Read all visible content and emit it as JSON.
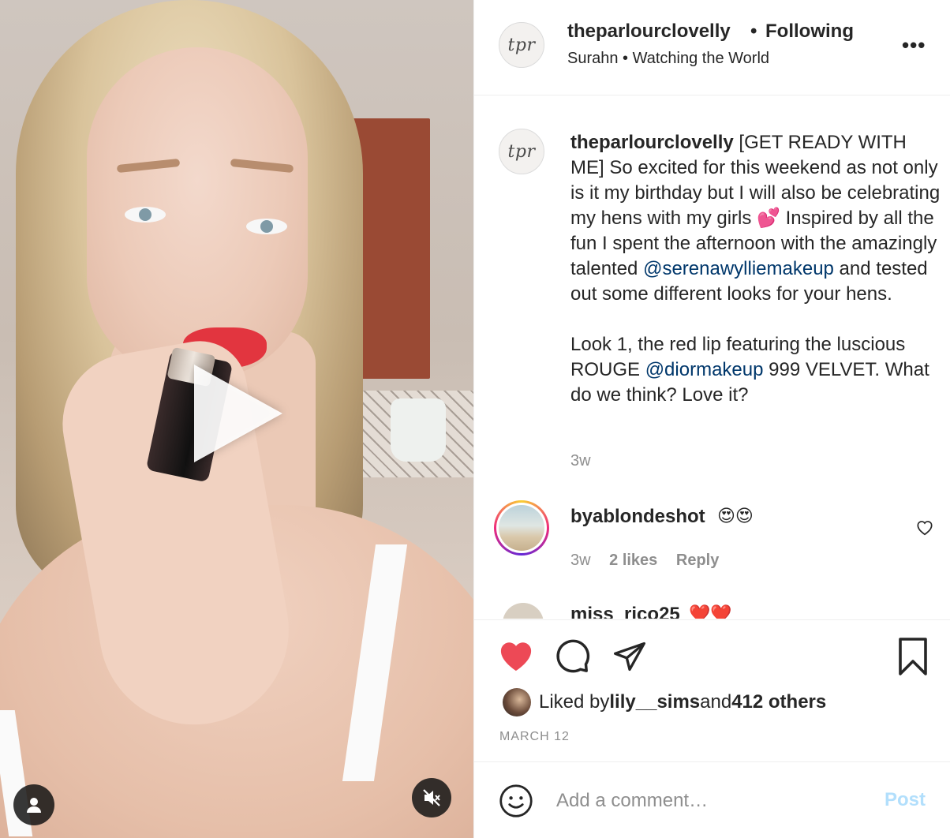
{
  "post": {
    "media": {
      "type": "video"
    },
    "header": {
      "avatar_text": "tpr",
      "username": "theparlourclovelly",
      "separator": "•",
      "follow_status": "Following",
      "subtitle": "Surahn • Watching the World",
      "more": "•••"
    },
    "caption": {
      "username": "theparlourclovelly",
      "text_1": " [GET READY WITH ME] So excited for this weekend as not only is it my birthday but I will also be celebrating my hens with my girls 💕 Inspired by all the fun I spent the afternoon with the amazingly talented ",
      "mention_1": "@serenawylliemakeup",
      "text_2": " and tested out some different looks for your hens.",
      "text_3": "Look 1, the red lip featuring the luscious ROUGE ",
      "mention_2": "@diormakeup",
      "text_4": " 999 VELVET. What do we think? Love it?",
      "time": "3w"
    },
    "comments": [
      {
        "username": "byablondeshot",
        "text": "😍😍",
        "time": "3w",
        "likes": "2 likes",
        "reply": "Reply"
      },
      {
        "username": "miss_rico25",
        "text": "❤️❤️"
      }
    ],
    "likes": {
      "prefix": "Liked by ",
      "user": "lily__sims",
      "middle": " and ",
      "others": "412 others"
    },
    "date": "MARCH 12",
    "add_comment": {
      "placeholder": "Add a comment…",
      "post_label": "Post"
    },
    "colors": {
      "like_heart": "#ed4956",
      "mention": "#00376b",
      "post_disabled": "#b2dffc",
      "muted_text": "#8e8e8e"
    }
  }
}
